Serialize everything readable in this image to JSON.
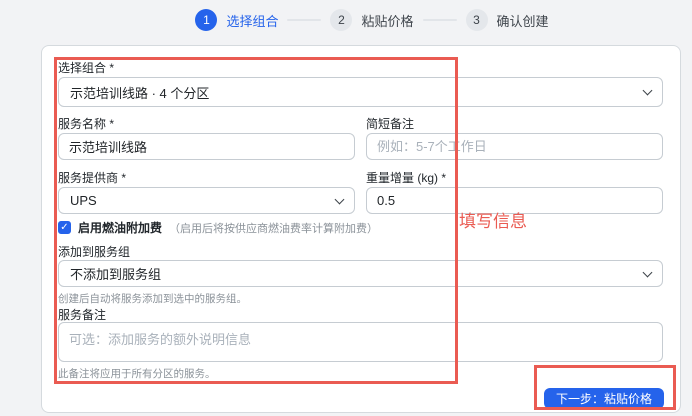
{
  "stepper": {
    "steps": [
      {
        "number": "1",
        "label": "选择组合"
      },
      {
        "number": "2",
        "label": "粘贴价格"
      },
      {
        "number": "3",
        "label": "确认创建"
      }
    ]
  },
  "form": {
    "combo": {
      "label": "选择组合 *",
      "value": "示范培训线路 · 4 个分区"
    },
    "service_name": {
      "label": "服务名称 *",
      "value": "示范培训线路"
    },
    "short_note": {
      "label": "简短备注",
      "placeholder": "例如：5-7个工作日"
    },
    "provider": {
      "label": "服务提供商 *",
      "value": "UPS"
    },
    "weight_increment": {
      "label": "重量增量 (kg) *",
      "value": "0.5"
    },
    "fuel_surcharge": {
      "checked": true,
      "checkmark": "✓",
      "label": "启用燃油附加费",
      "hint": "（启用后将按供应商燃油费率计算附加费）"
    },
    "service_group": {
      "label": "添加到服务组",
      "value": "不添加到服务组",
      "helper": "创建后自动将服务添加到选中的服务组。"
    },
    "service_note": {
      "label": "服务备注",
      "placeholder": "可选：添加服务的额外说明信息",
      "helper": "此备注将应用于所有分区的服务。"
    }
  },
  "footer": {
    "next_button": "下一步：粘贴价格"
  },
  "annotations": {
    "fill_info_label": "填写信息"
  },
  "colors": {
    "primary": "#2563eb",
    "annotation_red": "#ea5b52"
  }
}
